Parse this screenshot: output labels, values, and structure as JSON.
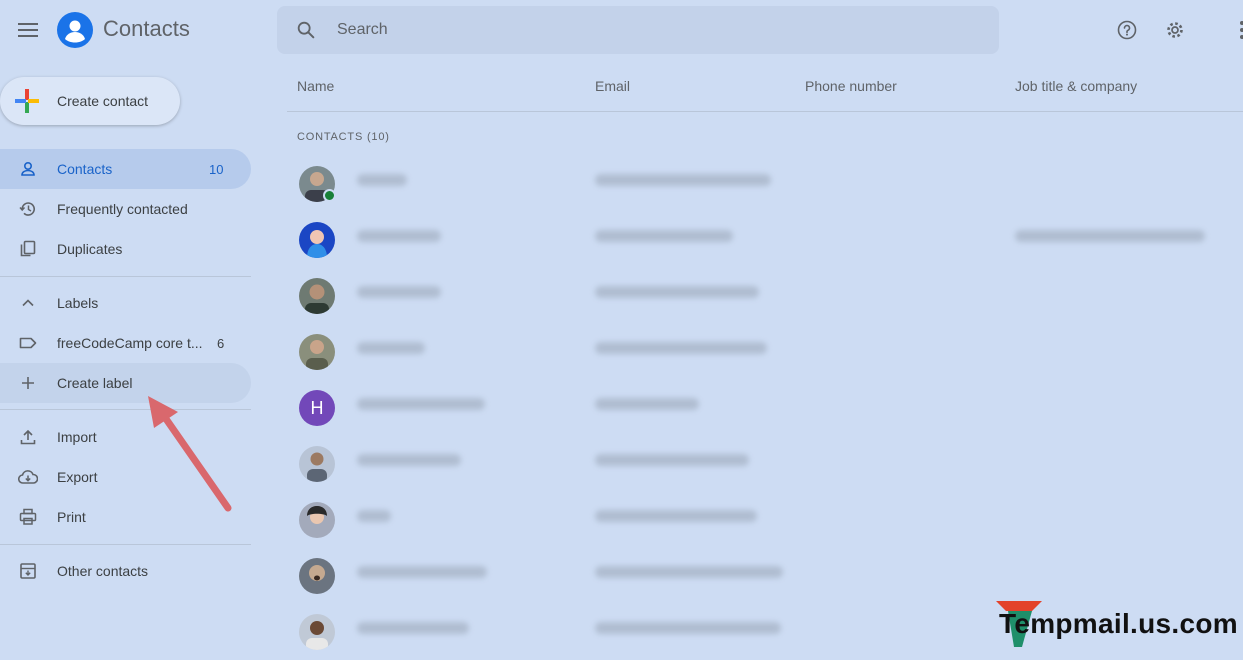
{
  "header": {
    "app_title": "Contacts",
    "search_placeholder": "Search",
    "icons": [
      "menu-icon",
      "search-icon",
      "help-icon",
      "settings-icon",
      "more-icon"
    ]
  },
  "sidebar": {
    "create_contact": "Create contact",
    "items": [
      {
        "label": "Contacts",
        "count": "10",
        "icon": "person-icon"
      },
      {
        "label": "Frequently contacted",
        "icon": "history-icon"
      },
      {
        "label": "Duplicates",
        "icon": "copy-icon"
      }
    ],
    "labels_header": "Labels",
    "labels": [
      {
        "label": "freeCodeCamp core t...",
        "count": "6",
        "icon": "label-icon"
      }
    ],
    "create_label": "Create label",
    "actions": [
      {
        "label": "Import",
        "icon": "upload-icon"
      },
      {
        "label": "Export",
        "icon": "cloud-download-icon"
      },
      {
        "label": "Print",
        "icon": "print-icon"
      }
    ],
    "other_contacts": "Other contacts"
  },
  "table": {
    "columns": [
      "Name",
      "Email",
      "Phone number",
      "Job title & company"
    ],
    "section_title": "CONTACTS (10)",
    "rows": [
      {
        "avatar": "photo",
        "letter": ""
      },
      {
        "avatar": "photo",
        "letter": ""
      },
      {
        "avatar": "photo",
        "letter": ""
      },
      {
        "avatar": "photo",
        "letter": ""
      },
      {
        "avatar": "letter",
        "letter": "H"
      },
      {
        "avatar": "photo",
        "letter": ""
      },
      {
        "avatar": "photo",
        "letter": ""
      },
      {
        "avatar": "photo",
        "letter": ""
      },
      {
        "avatar": "photo",
        "letter": ""
      }
    ]
  },
  "watermark": "Tempmail.us.com",
  "colors": {
    "accent": "#1a73e8",
    "background": "#cddcf3",
    "arrow": "#d9686d",
    "letter_avatar": "#7248b9"
  }
}
